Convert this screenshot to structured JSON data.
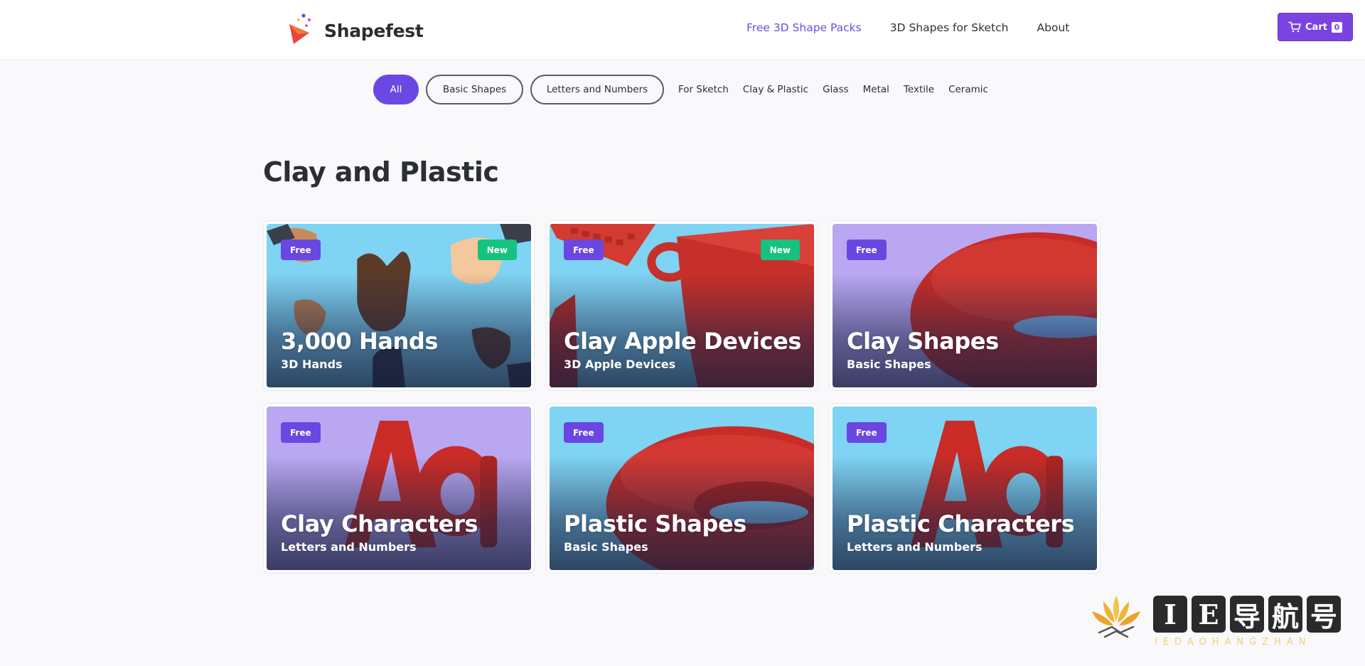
{
  "header": {
    "logo_text": "Shapefest",
    "nav": [
      {
        "label": "Free 3D Shape Packs",
        "active": true
      },
      {
        "label": "3D Shapes for Sketch",
        "active": false
      },
      {
        "label": "About",
        "active": false
      }
    ],
    "cart": {
      "label": "Cart",
      "count": "0"
    }
  },
  "filters": {
    "pills": [
      "All",
      "Basic Shapes",
      "Letters and Numbers"
    ],
    "links": [
      "For Sketch",
      "Clay & Plastic",
      "Glass",
      "Metal",
      "Textile",
      "Ceramic"
    ],
    "active": "All"
  },
  "section": {
    "title": "Clay and Plastic"
  },
  "cards": [
    {
      "title": "3,000 Hands",
      "subtitle": "3D Hands",
      "badge_free": "Free",
      "badge_new": "New",
      "theme": "hands"
    },
    {
      "title": "Clay Apple Devices",
      "subtitle": "3D Apple Devices",
      "badge_free": "Free",
      "badge_new": "New",
      "theme": "devices"
    },
    {
      "title": "Clay Shapes",
      "subtitle": "Basic Shapes",
      "badge_free": "Free",
      "badge_new": "",
      "theme": "torus-purple"
    },
    {
      "title": "Clay Characters",
      "subtitle": "Letters and Numbers",
      "badge_free": "Free",
      "badge_new": "",
      "theme": "letters-purple"
    },
    {
      "title": "Plastic Shapes",
      "subtitle": "Basic Shapes",
      "badge_free": "Free",
      "badge_new": "",
      "theme": "torus-blue"
    },
    {
      "title": "Plastic Characters",
      "subtitle": "Letters and Numbers",
      "badge_free": "Free",
      "badge_new": "",
      "theme": "letters-blue"
    }
  ],
  "colors": {
    "brand": "#6b47e3",
    "cart": "#7a43df",
    "new_badge": "#16c27f",
    "sky_blue": "#7fd3f3",
    "lavender": "#b9a7f2",
    "clay_red": "#d2332c"
  },
  "watermark": {
    "chars": [
      "I",
      "E",
      "导",
      "航",
      "号"
    ],
    "sub": "IEDAOHANGZHAN"
  }
}
